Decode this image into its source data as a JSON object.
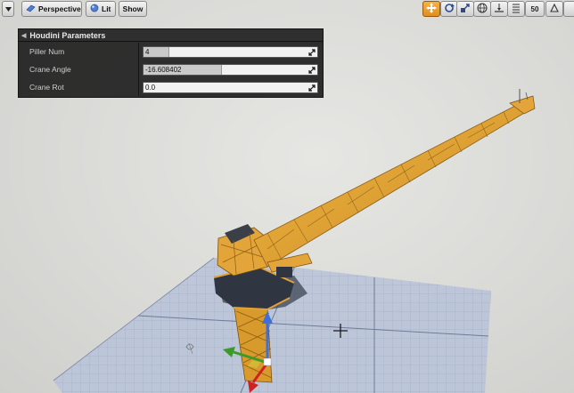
{
  "toolbar": {
    "perspective_label": "Perspective",
    "lit_label": "Lit",
    "show_label": "Show",
    "camera_speed": "50",
    "right_tools": [
      "translate-icon",
      "rotate-icon",
      "scale-icon",
      "world-icon",
      "surface-snap-icon",
      "grid-snap-icon",
      "angle-snap-icon"
    ]
  },
  "panel": {
    "title": "Houdini Parameters",
    "params": [
      {
        "label": "Piller Num",
        "value": "4",
        "slider_fraction": 0.15
      },
      {
        "label": "Crane Angle",
        "value": "-16.608402",
        "slider_fraction": 0.45
      },
      {
        "label": "Crane Rot",
        "value": "0.0",
        "slider_fraction": 0.0
      }
    ]
  },
  "colors": {
    "crane": "#e8a93a",
    "crane_dark": "#b77a1e",
    "grid_floor": "#b9c3d8",
    "gizmo_x": "#d22020",
    "gizmo_y": "#3c9a2a",
    "gizmo_z": "#3f6fd8",
    "active_tool": "#f0a232"
  }
}
